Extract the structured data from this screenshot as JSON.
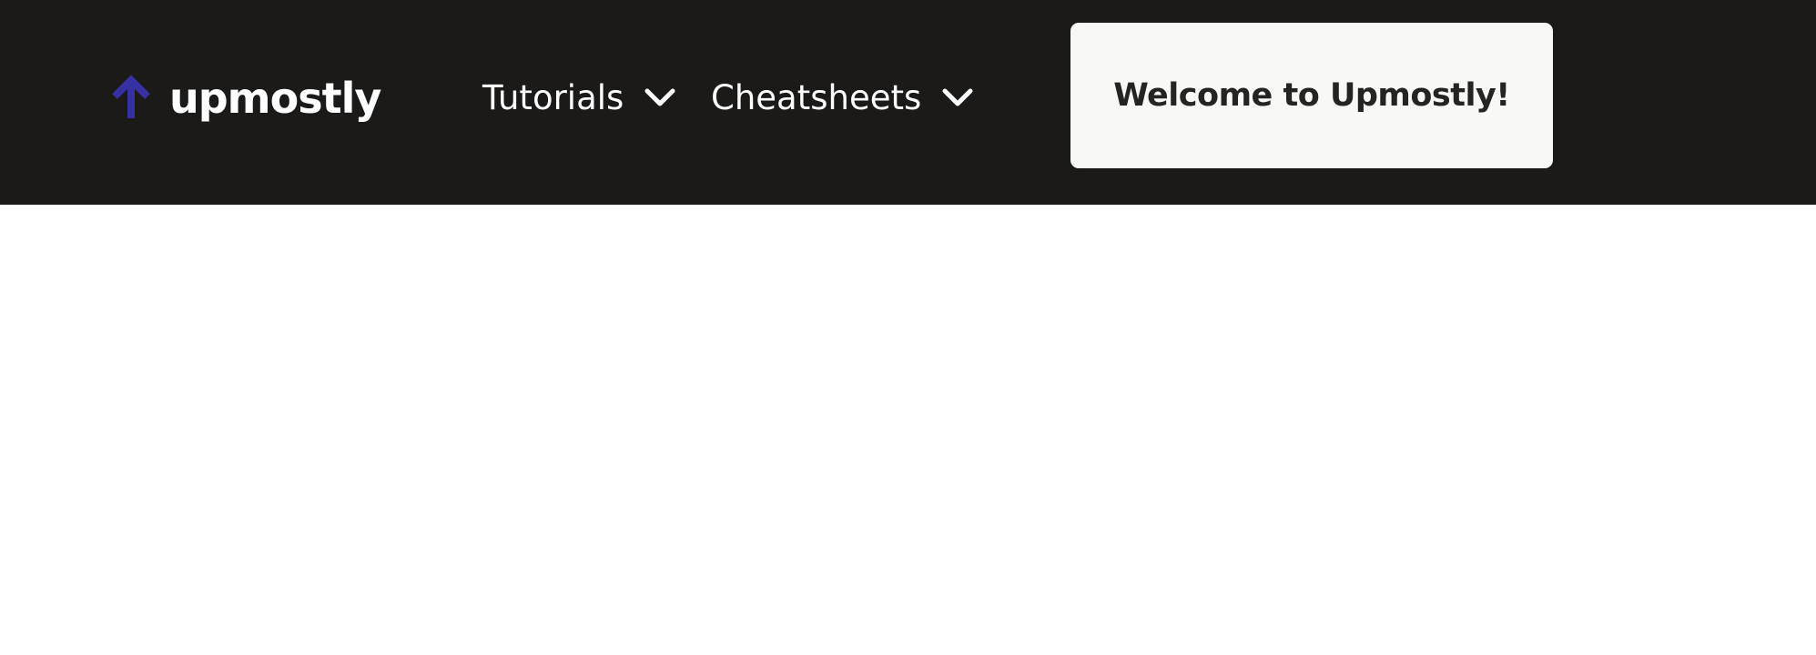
{
  "colors": {
    "navbar_background": "#1b1a19",
    "logo_arrow": "#3730a3",
    "nav_text": "#ffffff",
    "welcome_background": "#f8f8f6",
    "welcome_text": "#252423",
    "page_background": "#ffffff"
  },
  "header": {
    "logo": {
      "icon": "arrow-up-icon",
      "text": "upmostly"
    },
    "nav": [
      {
        "label": "Tutorials",
        "icon": "chevron-down-icon"
      },
      {
        "label": "Cheatsheets",
        "icon": "chevron-down-icon"
      }
    ],
    "welcome_button": {
      "label": "Welcome to Upmostly!"
    }
  }
}
